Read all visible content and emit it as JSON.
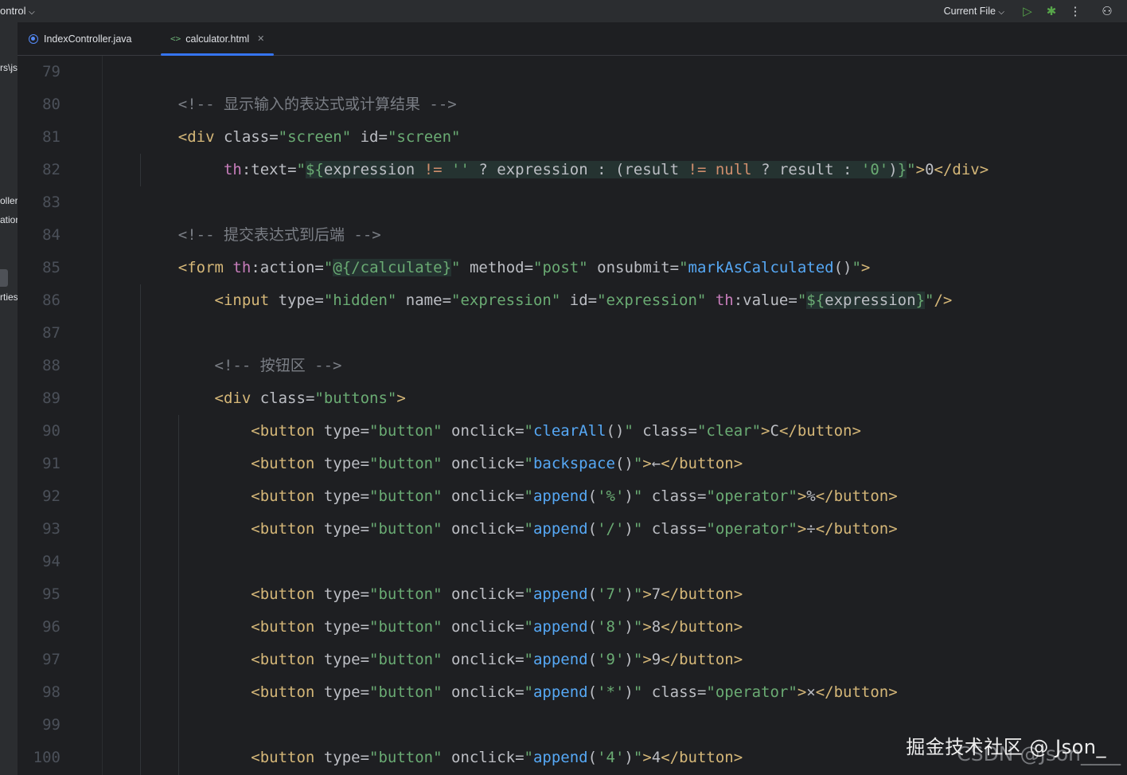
{
  "toolbar": {
    "left_text": "ontrol",
    "run_config": "Current File",
    "icons": [
      "chevron-down-icon",
      "run-icon",
      "debug-icon",
      "more-icon",
      "add-user-icon"
    ]
  },
  "sidebar": {
    "fragments": [
      "rs\\js",
      "oller",
      "atior",
      "rties"
    ]
  },
  "tabs": [
    {
      "label": "IndexController.java",
      "icon": "java-class-icon",
      "active": false
    },
    {
      "label": "calculator.html",
      "icon": "html-file-icon",
      "active": true
    }
  ],
  "lines": [
    {
      "n": "79",
      "html": ""
    },
    {
      "n": "80",
      "html": "    <span class='cm'>&lt;!-- </span><span class='cmzh'>显示输入的表达式或计算结果</span><span class='cm'> --&gt;</span>"
    },
    {
      "n": "81",
      "html": "    <span class='tag'>&lt;div</span> <span class='attr'>class</span>=<span class='val'>\"screen\"</span> <span class='attr'>id</span>=<span class='val'>\"screen\"</span>"
    },
    {
      "n": "82",
      "html": "         <span class='ns'>th</span>:<span class='attr'>text</span>=<span class='val'>\"</span><span class='hl'><span class='val'>${</span><span class='expr'>expression</span> <span class='kw'>!=</span> <span class='val'>''</span> ? <span class='expr'>expression</span> : (<span class='expr'>result</span> <span class='kw'>!=</span> <span class='kw'>null</span> ? <span class='expr'>result</span> : <span class='val'>'0'</span>)<span class='val'>}</span></span><span class='val'>\"</span><span class='tag'>&gt;</span>0<span class='tag'>&lt;/div&gt;</span>"
    },
    {
      "n": "83",
      "html": ""
    },
    {
      "n": "84",
      "html": "    <span class='cm'>&lt;!-- </span><span class='cmzh'>提交表达式到后端</span><span class='cm'> --&gt;</span>"
    },
    {
      "n": "85",
      "html": "    <span class='tag'>&lt;form</span> <span class='ns'>th</span>:<span class='attr'>action</span>=<span class='val'>\"</span><span class='hl'><span class='val'>@{/calculate}</span></span><span class='val'>\"</span> <span class='attr'>method</span>=<span class='val'>\"post\"</span> <span class='attr'>onsubmit</span>=<span class='val'>\"</span><span class='fn'>markAsCalculated</span>()<span class='val'>\"</span><span class='tag'>&gt;</span>"
    },
    {
      "n": "86",
      "html": "        <span class='tag'>&lt;input</span> <span class='attr'>type</span>=<span class='val'>\"hidden\"</span> <span class='attr'>name</span>=<span class='val'>\"expression\"</span> <span class='attr'>id</span>=<span class='val'>\"expression\"</span> <span class='ns'>th</span>:<span class='attr'>value</span>=<span class='val'>\"</span><span class='hl'><span class='val'>${</span><span class='expr'>expression</span><span class='val'>}</span></span><span class='val'>\"</span><span class='tag'>/&gt;</span>"
    },
    {
      "n": "87",
      "html": ""
    },
    {
      "n": "88",
      "html": "        <span class='cm'>&lt;!-- </span><span class='cmzh'>按钮区</span><span class='cm'> --&gt;</span>"
    },
    {
      "n": "89",
      "html": "        <span class='tag'>&lt;div</span> <span class='attr'>class</span>=<span class='val'>\"buttons\"</span><span class='tag'>&gt;</span>"
    },
    {
      "n": "90",
      "html": "            <span class='tag'>&lt;button</span> <span class='attr'>type</span>=<span class='val'>\"button\"</span> <span class='attr'>onclick</span>=<span class='val'>\"</span><span class='fn'>clearAll</span>()<span class='val'>\"</span> <span class='attr'>class</span>=<span class='val'>\"clear\"</span><span class='tag'>&gt;</span>C<span class='tag'>&lt;/button&gt;</span>"
    },
    {
      "n": "91",
      "html": "            <span class='tag'>&lt;button</span> <span class='attr'>type</span>=<span class='val'>\"button\"</span> <span class='attr'>onclick</span>=<span class='val'>\"</span><span class='fn'>backspace</span>()<span class='val'>\"</span><span class='tag'>&gt;</span>←<span class='tag'>&lt;/button&gt;</span>"
    },
    {
      "n": "92",
      "html": "            <span class='tag'>&lt;button</span> <span class='attr'>type</span>=<span class='val'>\"button\"</span> <span class='attr'>onclick</span>=<span class='val'>\"</span><span class='fn'>append</span>(<span class='val'>'%'</span>)<span class='val'>\"</span> <span class='attr'>class</span>=<span class='val'>\"operator\"</span><span class='tag'>&gt;</span>%<span class='tag'>&lt;/button&gt;</span>"
    },
    {
      "n": "93",
      "html": "            <span class='tag'>&lt;button</span> <span class='attr'>type</span>=<span class='val'>\"button\"</span> <span class='attr'>onclick</span>=<span class='val'>\"</span><span class='fn'>append</span>(<span class='val'>'/'</span>)<span class='val'>\"</span> <span class='attr'>class</span>=<span class='val'>\"operator\"</span><span class='tag'>&gt;</span>÷<span class='tag'>&lt;/button&gt;</span>"
    },
    {
      "n": "94",
      "html": ""
    },
    {
      "n": "95",
      "html": "            <span class='tag'>&lt;button</span> <span class='attr'>type</span>=<span class='val'>\"button\"</span> <span class='attr'>onclick</span>=<span class='val'>\"</span><span class='fn'>append</span>(<span class='val'>'7'</span>)<span class='val'>\"</span><span class='tag'>&gt;</span>7<span class='tag'>&lt;/button&gt;</span>"
    },
    {
      "n": "96",
      "html": "            <span class='tag'>&lt;button</span> <span class='attr'>type</span>=<span class='val'>\"button\"</span> <span class='attr'>onclick</span>=<span class='val'>\"</span><span class='fn'>append</span>(<span class='val'>'8'</span>)<span class='val'>\"</span><span class='tag'>&gt;</span>8<span class='tag'>&lt;/button&gt;</span>"
    },
    {
      "n": "97",
      "html": "            <span class='tag'>&lt;button</span> <span class='attr'>type</span>=<span class='val'>\"button\"</span> <span class='attr'>onclick</span>=<span class='val'>\"</span><span class='fn'>append</span>(<span class='val'>'9'</span>)<span class='val'>\"</span><span class='tag'>&gt;</span>9<span class='tag'>&lt;/button&gt;</span>"
    },
    {
      "n": "98",
      "html": "            <span class='tag'>&lt;button</span> <span class='attr'>type</span>=<span class='val'>\"button\"</span> <span class='attr'>onclick</span>=<span class='val'>\"</span><span class='fn'>append</span>(<span class='val'>'*'</span>)<span class='val'>\"</span> <span class='attr'>class</span>=<span class='val'>\"operator\"</span><span class='tag'>&gt;</span>×<span class='tag'>&lt;/button&gt;</span>"
    },
    {
      "n": "99",
      "html": ""
    },
    {
      "n": "100",
      "html": "            <span class='tag'>&lt;button</span> <span class='attr'>type</span>=<span class='val'>\"button\"</span> <span class='attr'>onclick</span>=<span class='val'>\"</span><span class='fn'>append</span>(<span class='val'>'4'</span>)<span class='val'>\"</span><span class='tag'>&gt;</span>4<span class='tag'>&lt;/button&gt;</span>"
    }
  ],
  "watermark": {
    "primary": "掘金技术社区 @ Json_",
    "secondary": "CSDN @Json____"
  },
  "colors": {
    "background": "#1e1f22",
    "tag": "#d5b778",
    "string": "#6aab73",
    "function": "#56a8f5",
    "namespace": "#c77dbb",
    "comment": "#7a7e85",
    "accent": "#3574f0"
  }
}
